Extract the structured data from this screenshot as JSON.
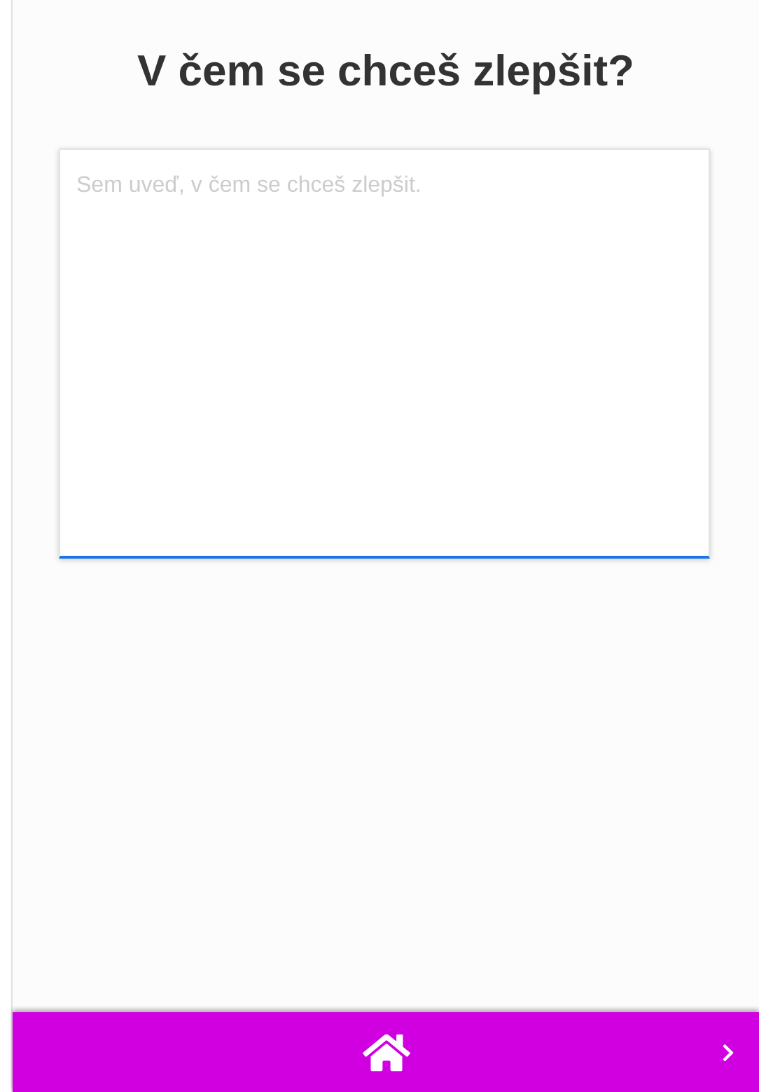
{
  "title": "V čem se chceš zlepšit?",
  "answer": {
    "placeholder": "Sem uveď, v čem se chceš zlepšit."
  }
}
